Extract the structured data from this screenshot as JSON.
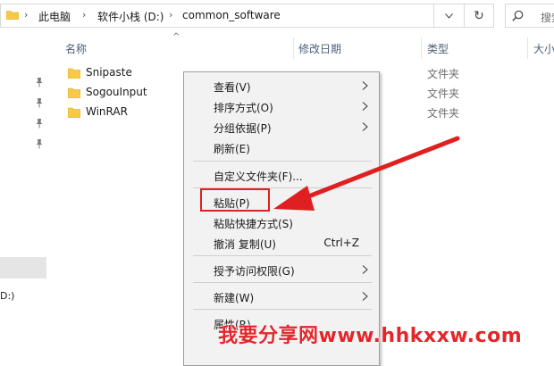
{
  "address_bar": {
    "breadcrumbs": [
      "此电脑",
      "软件小栈 (D:)",
      "common_software"
    ]
  },
  "search": {
    "placeholder": "搜索"
  },
  "columns": {
    "name": "名称",
    "date": "修改日期",
    "type": "类型",
    "size": "大小"
  },
  "files": [
    {
      "name": "Snipaste",
      "type": "文件夹"
    },
    {
      "name": "SogouInput",
      "type": "文件夹"
    },
    {
      "name": "WinRAR",
      "type": "文件夹"
    }
  ],
  "nav_pane": {
    "drive_label": "D:)"
  },
  "context_menu": {
    "items": [
      {
        "label": "查看(V)",
        "has_submenu": true
      },
      {
        "label": "排序方式(O)",
        "has_submenu": true
      },
      {
        "label": "分组依据(P)",
        "has_submenu": true
      },
      {
        "label": "刷新(E)",
        "has_submenu": false
      },
      {
        "label": "自定义文件夹(F)...",
        "has_submenu": false
      },
      {
        "label": "粘贴(P)",
        "has_submenu": false
      },
      {
        "label": "粘贴快捷方式(S)",
        "has_submenu": false
      },
      {
        "label": "撤消 复制(U)",
        "shortcut": "Ctrl+Z",
        "has_submenu": false
      },
      {
        "label": "授予访问权限(G)",
        "has_submenu": true
      },
      {
        "label": "新建(W)",
        "has_submenu": true
      },
      {
        "label": "属性(R)",
        "has_submenu": false
      }
    ]
  },
  "watermark": {
    "text": "我要分享网www.hhkxxw.com"
  },
  "colors": {
    "annotation_red": "#e02020",
    "folder_yellow": "#f7c948",
    "header_text": "#4c607a"
  }
}
